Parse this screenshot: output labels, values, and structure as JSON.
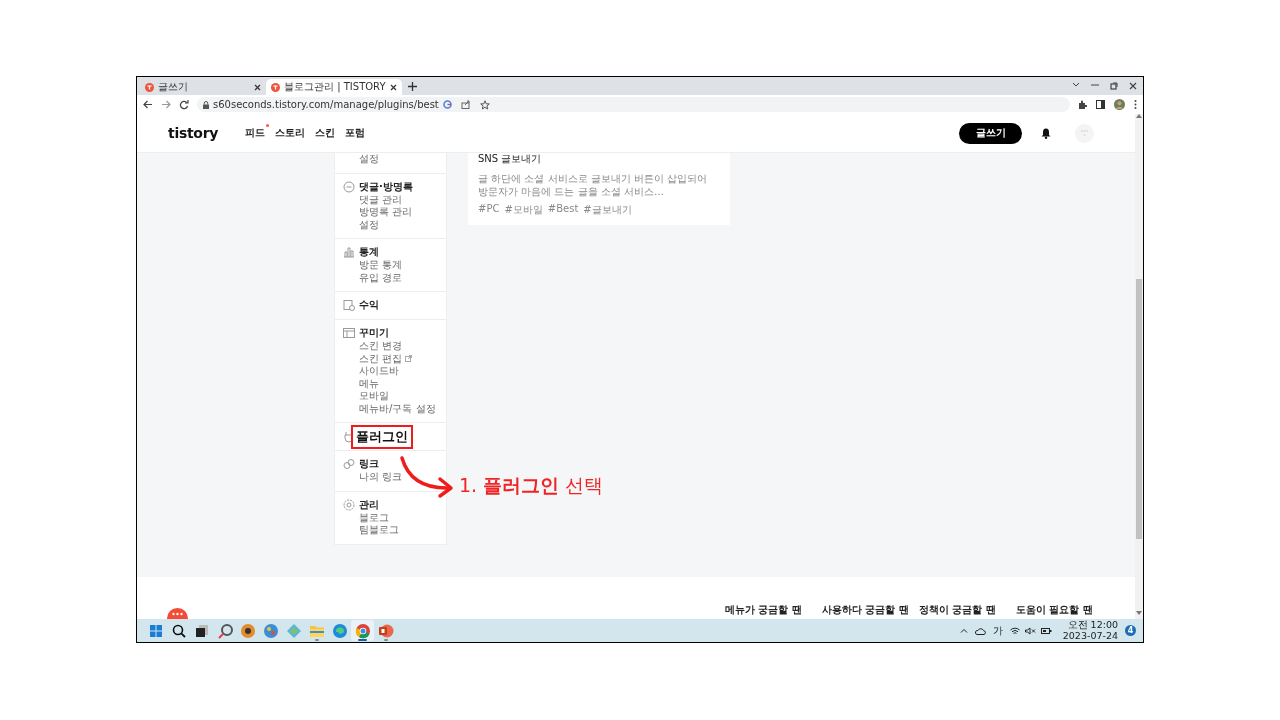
{
  "browser": {
    "tabs": [
      {
        "title": "글쓰기",
        "selected": false
      },
      {
        "title": "블로그관리 | TISTORY",
        "selected": true
      }
    ],
    "url": "s60seconds.tistory.com/manage/plugins/best"
  },
  "header": {
    "logo": "tistory",
    "nav": [
      {
        "label": "피드",
        "new": true
      },
      {
        "label": "스토리",
        "new": false
      },
      {
        "label": "스킨",
        "new": false
      },
      {
        "label": "포럼",
        "new": false
      }
    ],
    "write_button": "글쓰기"
  },
  "sidebar": {
    "sections": [
      {
        "kind": "partial",
        "items": [
          {
            "label": "설정",
            "external": false
          }
        ]
      },
      {
        "kind": "comment",
        "title": "댓글·방명록",
        "highlighted": false,
        "items": [
          {
            "label": "댓글 관리",
            "external": false
          },
          {
            "label": "방명록 관리",
            "external": false
          },
          {
            "label": "설정",
            "external": false
          }
        ]
      },
      {
        "kind": "stats",
        "title": "통계",
        "highlighted": false,
        "items": [
          {
            "label": "방문 통계",
            "external": false
          },
          {
            "label": "유입 경로",
            "external": false
          }
        ]
      },
      {
        "kind": "revenue",
        "title": "수익",
        "highlighted": false
      },
      {
        "kind": "layout",
        "title": "꾸미기",
        "highlighted": false,
        "items": [
          {
            "label": "스킨 변경",
            "external": false
          },
          {
            "label": "스킨 편집",
            "external": true
          },
          {
            "label": "사이드바",
            "external": false
          },
          {
            "label": "메뉴",
            "external": false
          },
          {
            "label": "모바일",
            "external": false
          },
          {
            "label": "메뉴바/구독 설정",
            "external": false
          }
        ]
      },
      {
        "kind": "plugin",
        "title": "플러그인",
        "highlighted": true
      },
      {
        "kind": "link",
        "title": "링크",
        "highlighted": false,
        "items": [
          {
            "label": "나의 링크",
            "external": false
          }
        ]
      },
      {
        "kind": "settings",
        "title": "관리",
        "highlighted": false,
        "items": [
          {
            "label": "블로그",
            "external": false
          },
          {
            "label": "팀블로그",
            "external": false
          }
        ]
      }
    ]
  },
  "card": {
    "title": "SNS 글보내기",
    "description": "글 하단에 소셜 서비스로 글보내기 버튼이 삽입되어 방문자가 마음에 드는 글을 소셜 서비스…",
    "tags": [
      "#PC",
      "#모바일",
      "#Best",
      "#글보내기"
    ]
  },
  "annotation": {
    "text": "1. **플러그인** 선택"
  },
  "footer": {
    "links": [
      "메뉴가 궁금할 땐",
      "사용하다 궁금할 땐",
      "정책이 궁금할 땐",
      "도움이 필요할 땐"
    ]
  },
  "taskbar": {
    "apps": [
      {
        "running": false,
        "selected": false
      },
      {
        "running": false,
        "selected": false
      },
      {
        "running": false,
        "selected": false
      },
      {
        "running": false,
        "selected": false
      },
      {
        "running": true,
        "selected": false
      },
      {
        "running": false,
        "selected": false
      },
      {
        "running": true,
        "selected": true
      },
      {
        "running": true,
        "selected": false
      }
    ],
    "ime": "가",
    "time": "오전 12:00",
    "date": "2023-07-24",
    "notifications": "4"
  }
}
